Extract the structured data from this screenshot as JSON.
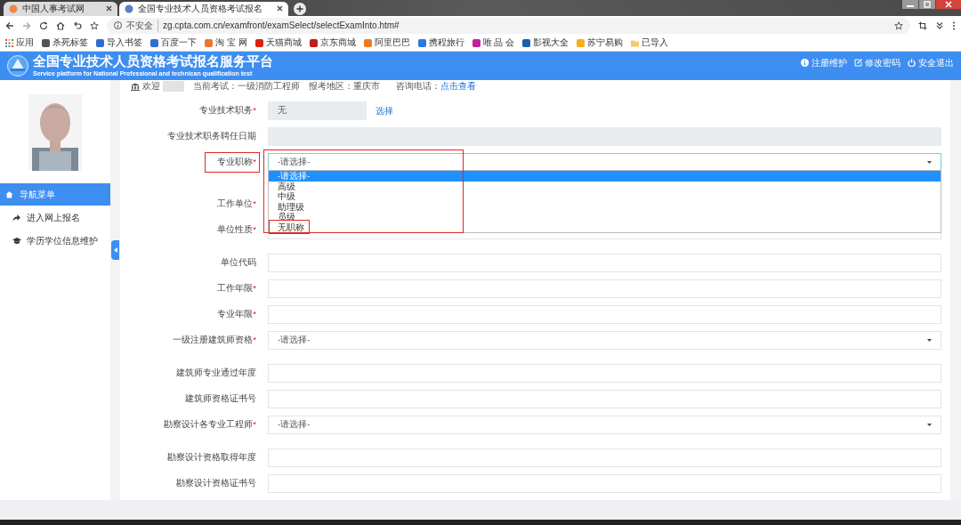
{
  "browser": {
    "tabs": [
      {
        "title": "中国人事考试网",
        "selected": false
      },
      {
        "title": "全国专业技术人员资格考试报名",
        "selected": true
      }
    ],
    "security": "不安全",
    "url": "zg.cpta.com.cn/examfront/examSelect/selectExamInto.htm#",
    "bookmarks": [
      "应用",
      "杀死标签",
      "导入书签",
      "百度一下",
      "淘 宝 网",
      "天猫商城",
      "京东商城",
      "阿里巴巴",
      "携程旅行",
      "唯 品 会",
      "影视大全",
      "苏宁易购",
      "已导入"
    ]
  },
  "header": {
    "title": "全国专业技术人员资格考试报名服务平台",
    "subtitle": "Service platform for National Professional and technican qualification test",
    "actions": [
      {
        "kind": "info",
        "label": "注册维护"
      },
      {
        "kind": "edit",
        "label": "修改密码"
      },
      {
        "kind": "power",
        "label": "安全退出"
      }
    ]
  },
  "sidebar": {
    "items": [
      {
        "kind": "home",
        "label": "导航菜单",
        "selected": true
      },
      {
        "kind": "share",
        "label": "进入网上报名",
        "selected": false
      },
      {
        "kind": "cap",
        "label": "学历学位信息维护",
        "selected": false
      }
    ]
  },
  "info_bar": {
    "welcome": "欢迎",
    "exam": "当前考试：一级消防工程师",
    "region": "报考地区：重庆市",
    "phone_label": "咨询电话：",
    "phone_link": "点击查看"
  },
  "form": {
    "fields": [
      {
        "kind": "readonly",
        "label": "专业技术职务",
        "mark": "*",
        "value": "无",
        "link": "选择"
      },
      {
        "kind": "readonly_wide",
        "label": "专业技术职务聘任日期"
      },
      {
        "kind": "select",
        "label": "专业职称",
        "mark": "*",
        "value": "-请选择-",
        "open": true,
        "highlighted": true,
        "list_highlighted": true,
        "options": [
          {
            "label": "-请选择-",
            "selected": true,
            "highlighted": false
          },
          {
            "label": "高级",
            "selected": false,
            "highlighted": false
          },
          {
            "label": "中级",
            "selected": false,
            "highlighted": false
          },
          {
            "label": "助理级",
            "selected": false,
            "highlighted": false
          },
          {
            "label": "员级",
            "selected": false,
            "highlighted": false
          },
          {
            "label": "无职称",
            "selected": false,
            "highlighted": true
          }
        ]
      },
      {
        "kind": "covered",
        "label": "工作单位",
        "mark": "*"
      },
      {
        "kind": "select",
        "label": "单位性质",
        "mark": "*"
      },
      {
        "kind": "text",
        "label": "单位代码"
      },
      {
        "kind": "text",
        "label": "工作年限",
        "mark": "*"
      },
      {
        "kind": "text",
        "label": "专业年限",
        "mark": "*"
      },
      {
        "kind": "select",
        "label": "一级注册建筑师资格",
        "mark": "*",
        "value": "-请选择-"
      },
      {
        "kind": "text",
        "label": "建筑师专业通过年度"
      },
      {
        "kind": "text",
        "label": "建筑师资格证书号"
      },
      {
        "kind": "select",
        "label": "勘察设计各专业工程师",
        "mark": "*",
        "value": "-请选择-"
      },
      {
        "kind": "text",
        "label": "勘察设计资格取得年度"
      },
      {
        "kind": "text",
        "label": "勘察设计资格证书号"
      }
    ]
  }
}
